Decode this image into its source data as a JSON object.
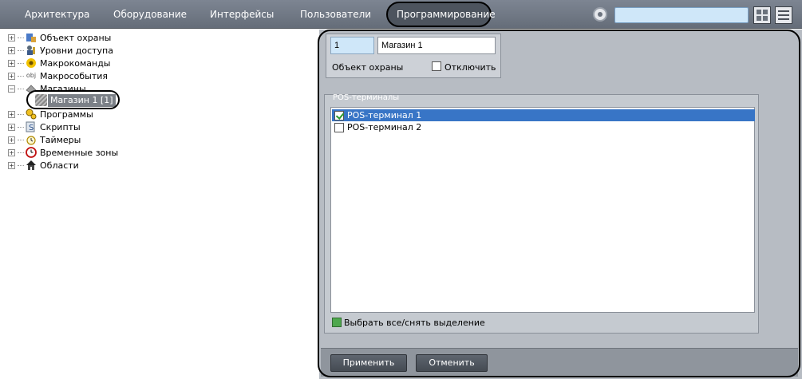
{
  "menu": {
    "items": [
      {
        "label": "Архитектура"
      },
      {
        "label": "Оборудование"
      },
      {
        "label": "Интерфейсы"
      },
      {
        "label": "Пользователи"
      },
      {
        "label": "Программирование",
        "active": true
      }
    ],
    "search_value": ""
  },
  "tree": {
    "items": [
      {
        "label": "Объект охраны",
        "icon": "shield-object-icon"
      },
      {
        "label": "Уровни доступа",
        "icon": "access-level-icon"
      },
      {
        "label": "Макрокоманды",
        "icon": "macro-icon"
      },
      {
        "label": "Макрособытия",
        "icon": "obj-macroevent-icon",
        "icon_text": "obj"
      },
      {
        "label": "Магазины",
        "icon": "shop-icon"
      },
      {
        "label": "Программы",
        "icon": "program-icon"
      },
      {
        "label": "Скрипты",
        "icon": "script-icon"
      },
      {
        "label": "Таймеры",
        "icon": "timer-icon"
      },
      {
        "label": "Временные зоны",
        "icon": "clock-icon"
      },
      {
        "label": "Области",
        "icon": "home-icon"
      }
    ],
    "selected_child": "Магазин 1 [1]"
  },
  "object": {
    "id": "1",
    "name": "Магазин 1",
    "type_label": "Объект охраны",
    "disable_label": "Отключить",
    "disabled": false
  },
  "pos": {
    "group_title": "POS-терминалы",
    "items": [
      {
        "label": "POS-терминал 1",
        "checked": true,
        "selected": true
      },
      {
        "label": "POS-терминал 2",
        "checked": false,
        "selected": false
      }
    ],
    "select_all_label": "Выбрать все/снять выделение"
  },
  "buttons": {
    "apply": "Применить",
    "cancel": "Отменить"
  },
  "colors": {
    "menubar": "#6f7783",
    "selection": "#3875c6",
    "panel": "#b7bcc3"
  }
}
